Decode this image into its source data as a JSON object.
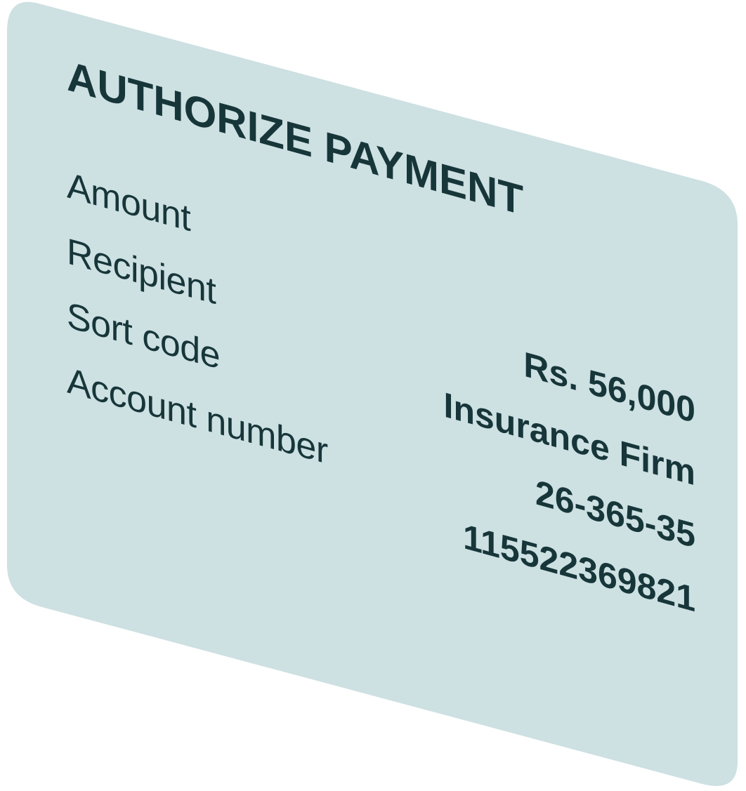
{
  "card": {
    "background_color": "#cde0e2",
    "text_color": "#17363a",
    "title": "AUTHORIZE PAYMENT",
    "rows": [
      {
        "label": "Amount",
        "value": "Rs. 56,000"
      },
      {
        "label": "Recipient",
        "value": "Insurance Firm"
      },
      {
        "label": "Sort code",
        "value": "26-365-35"
      },
      {
        "label": "Account number",
        "value": "115522369821"
      }
    ]
  }
}
